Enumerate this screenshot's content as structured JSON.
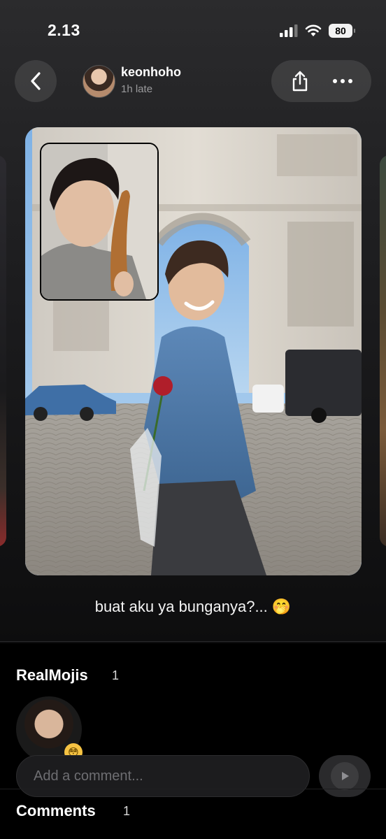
{
  "status_bar": {
    "time": "2.13",
    "battery": "80",
    "icons": [
      "cellular-signal-icon",
      "wifi-icon",
      "battery-icon"
    ]
  },
  "header": {
    "username": "keonhoho",
    "time_ago": "1h late",
    "icons": [
      "back-chevron-icon",
      "share-icon",
      "more-icon"
    ]
  },
  "post": {
    "caption": "buat aku ya bunganya?... 🤭"
  },
  "realmojis": {
    "title": "RealMojis",
    "count": "1",
    "reaction_emoji": "😳"
  },
  "comment_input": {
    "placeholder": "Add a comment..."
  },
  "comments": {
    "title": "Comments",
    "count": "1"
  },
  "colors": {
    "background": "#000000",
    "surface": "#1c1c1e",
    "muted_text": "#9a9a9c"
  }
}
